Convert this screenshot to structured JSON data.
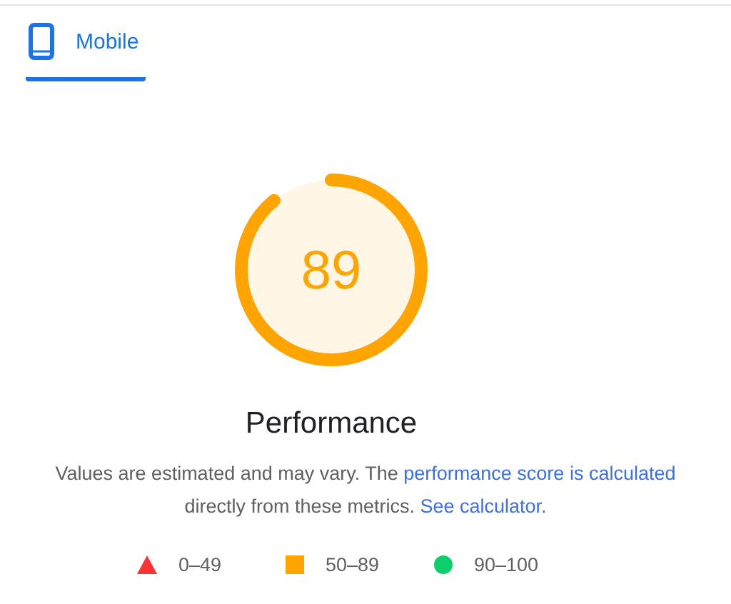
{
  "tabs": [
    {
      "label": "Mobile",
      "selected": true
    }
  ],
  "gauge": {
    "score": "89",
    "level": 0.89,
    "color": "#ffa400"
  },
  "title": "Performance",
  "description": [
    {
      "kind": "text",
      "text": "Values are estimated and may vary. The "
    },
    {
      "kind": "link",
      "text": "performance score is calculated"
    },
    {
      "kind": "text",
      "text": " directly from these metrics. "
    },
    {
      "kind": "link",
      "text": "See calculator."
    }
  ],
  "legend": [
    {
      "kind": "triangle",
      "color": "#ff3333",
      "label": "0–49"
    },
    {
      "kind": "square",
      "color": "#ffa400",
      "label": "50–89"
    },
    {
      "kind": "circle",
      "color": "#0cce6b",
      "label": "90–100"
    }
  ]
}
